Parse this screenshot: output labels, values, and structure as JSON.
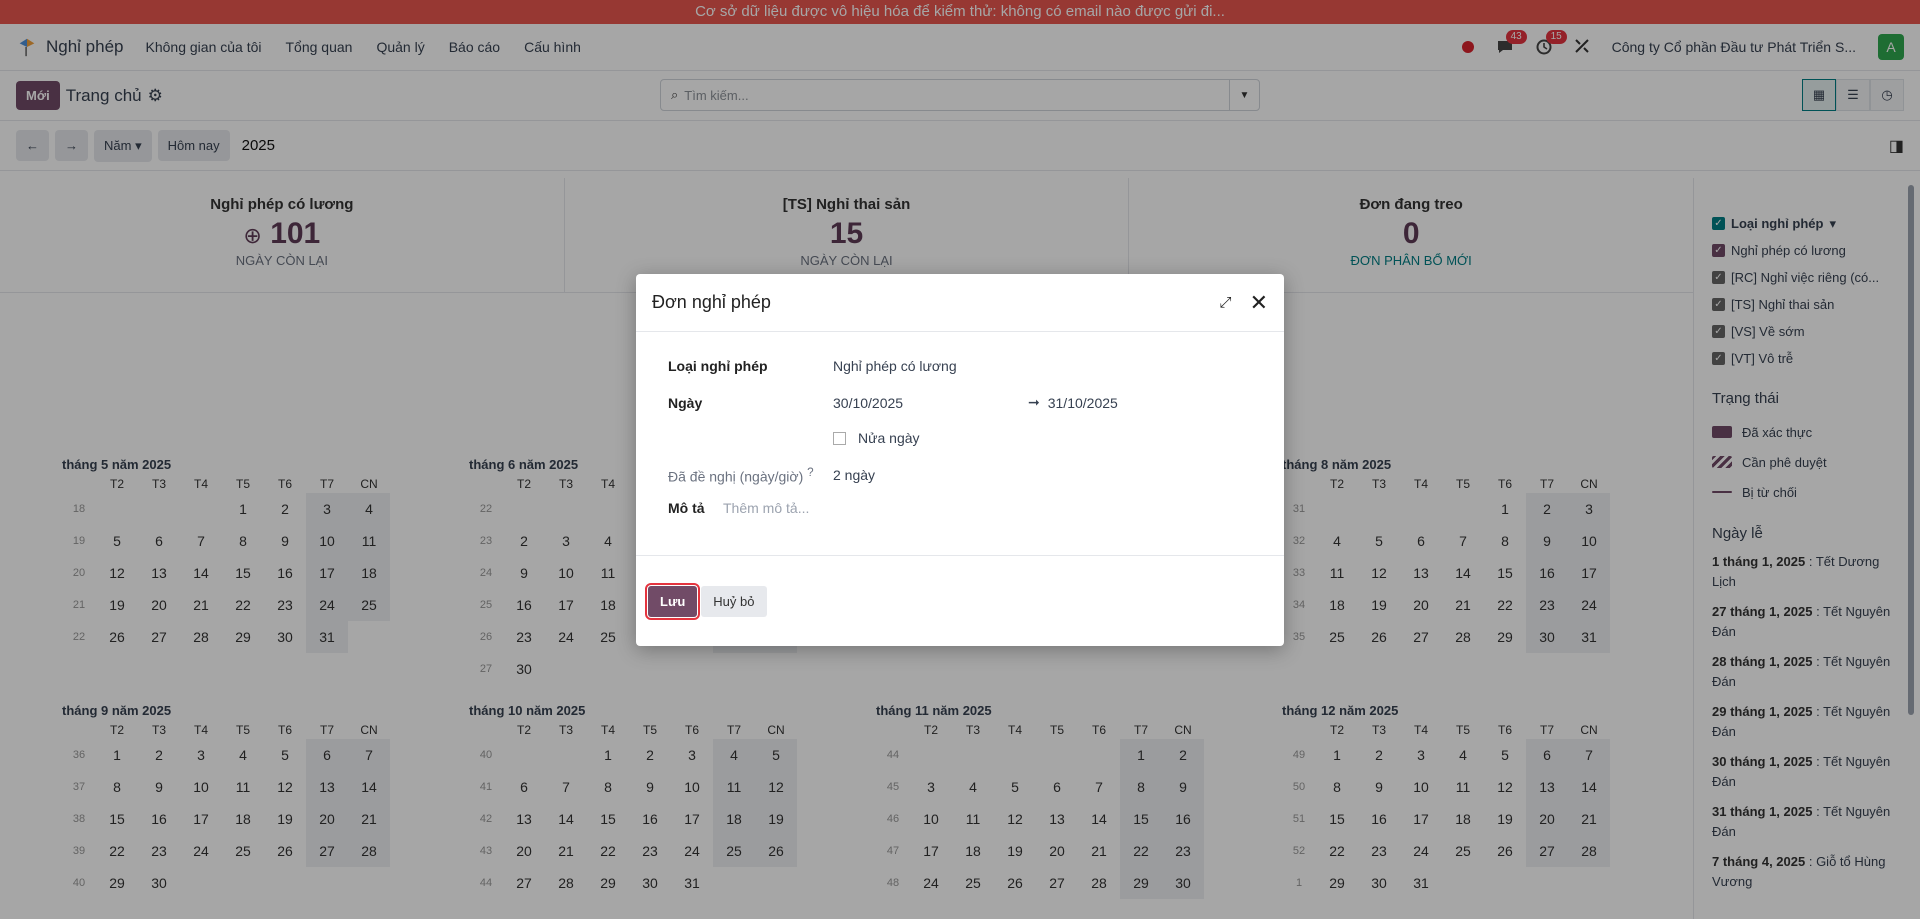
{
  "banner": "Cơ sở dữ liệu được vô hiệu hóa để kiểm thử: không có email nào được gửi đi...",
  "navbar": {
    "app": "Nghỉ phép",
    "menu": [
      "Không gian của tôi",
      "Tổng quan",
      "Quản lý",
      "Báo cáo",
      "Cấu hình"
    ],
    "chat_count": "43",
    "activity_count": "15",
    "company": "Công ty Cổ phần Đầu tư Phát Triển S...",
    "avatar": "A"
  },
  "control": {
    "new": "Mới",
    "breadcrumb": "Trang chủ",
    "search_placeholder": "Tìm kiếm..."
  },
  "toolbar": {
    "scale": "Năm",
    "today": "Hôm nay",
    "year": "2025"
  },
  "summary": [
    {
      "title": "Nghỉ phép có lương",
      "value": "101",
      "sub": "NGÀY CÒN LẠI"
    },
    {
      "title": "[TS] Nghỉ thai sản",
      "value": "15",
      "sub": "NGÀY CÒN LẠI"
    },
    {
      "title": "Đơn đang treo",
      "value": "0",
      "sub": "ĐƠN PHÂN BỔ MỚI"
    }
  ],
  "weekdays": [
    "T2",
    "T3",
    "T4",
    "T5",
    "T6",
    "T7",
    "CN"
  ],
  "months": [
    {
      "title": "tháng 5 năm 2025",
      "weeks": [
        "18",
        "19",
        "20",
        "21",
        "22"
      ],
      "offset": 3,
      "days": 31
    },
    {
      "title": "tháng 6 năm 2025",
      "weeks": [
        "22",
        "23",
        "24",
        "25",
        "26",
        "27"
      ],
      "offset": 6,
      "days": 30
    },
    {
      "title": "tháng 8 năm 2025",
      "weeks": [
        "31",
        "32",
        "33",
        "34",
        "35"
      ],
      "offset": 4,
      "days": 31
    },
    {
      "title": "tháng 9 năm 2025",
      "weeks": [
        "36",
        "37",
        "38",
        "39",
        "40"
      ],
      "offset": 0,
      "days": 30
    },
    {
      "title": "tháng 10 năm 2025",
      "weeks": [
        "40",
        "41",
        "42",
        "43",
        "44"
      ],
      "offset": 2,
      "days": 31
    },
    {
      "title": "tháng 11 năm 2025",
      "weeks": [
        "44",
        "45",
        "46",
        "47",
        "48"
      ],
      "offset": 5,
      "days": 30
    },
    {
      "title": "tháng 12 năm 2025",
      "weeks": [
        "49",
        "50",
        "51",
        "52",
        "1"
      ],
      "offset": 0,
      "days": 31
    }
  ],
  "sidebar": {
    "filter_title": "Loại nghỉ phép",
    "filters": [
      "Nghỉ phép có lương",
      "[RC] Nghỉ việc riêng (có...",
      "[TS] Nghỉ thai sản",
      "[VS] Về sớm",
      "[VT] Vô trễ"
    ],
    "status_title": "Trạng thái",
    "status": [
      "Đã xác thực",
      "Cần phê duyệt",
      "Bị từ chối"
    ],
    "holiday_title": "Ngày lễ",
    "holidays": [
      {
        "date": "1 tháng 1, 2025",
        "name": "Tết Dương Lịch"
      },
      {
        "date": "27 tháng 1, 2025",
        "name": "Tết Nguyên Đán"
      },
      {
        "date": "28 tháng 1, 2025",
        "name": "Tết Nguyên Đán"
      },
      {
        "date": "29 tháng 1, 2025",
        "name": "Tết Nguyên Đán"
      },
      {
        "date": "30 tháng 1, 2025",
        "name": "Tết Nguyên Đán"
      },
      {
        "date": "31 tháng 1, 2025",
        "name": "Tết Nguyên Đán"
      },
      {
        "date": "7 tháng 4, 2025",
        "name": "Giỗ tổ Hùng Vương"
      }
    ]
  },
  "modal": {
    "title": "Đơn nghỉ phép",
    "type_label": "Loại nghỉ phép",
    "type_value": "Nghỉ phép có lương",
    "date_label": "Ngày",
    "date_from": "30/10/2025",
    "date_to": "31/10/2025",
    "half_day": "Nửa ngày",
    "requested_label": "Đã đề nghị (ngày/giờ)",
    "requested_value": "2 ngày",
    "desc_label": "Mô tả",
    "desc_placeholder": "Thêm mô tả...",
    "save": "Lưu",
    "cancel": "Huỷ bỏ"
  }
}
